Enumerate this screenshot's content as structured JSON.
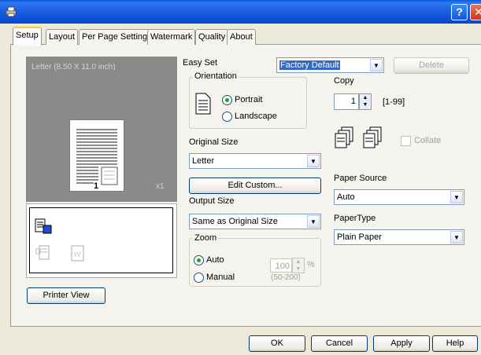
{
  "window": {
    "help_button": "?",
    "close_button": "✕"
  },
  "tabs": [
    "Setup",
    "Layout",
    "Per Page Setting",
    "Watermark",
    "Quality",
    "About"
  ],
  "preview": {
    "paper_label": "Letter  (8.50 X 11.0 inch)",
    "page_number": "1",
    "copies_marker": "x1",
    "printer_view_button": "Printer View"
  },
  "easy_set": {
    "label": "Easy Set",
    "value": "Factory Default",
    "delete_button": "Delete"
  },
  "orientation": {
    "legend": "Orientation",
    "portrait": "Portrait",
    "landscape": "Landscape",
    "selected": "Portrait"
  },
  "original_size": {
    "label": "Original Size",
    "value": "Letter",
    "edit_custom_button": "Edit Custom..."
  },
  "output_size": {
    "label": "Output Size",
    "value": "Same as Original Size"
  },
  "zoom": {
    "legend": "Zoom",
    "auto": "Auto",
    "manual": "Manual",
    "selected": "Auto",
    "value": "100",
    "unit": "%",
    "range": "(50-200)"
  },
  "copy": {
    "label": "Copy",
    "value": "1",
    "range": "[1-99]",
    "collate_label": "Collate"
  },
  "paper_source": {
    "label": "Paper Source",
    "value": "Auto"
  },
  "paper_type": {
    "label": "PaperType",
    "value": "Plain Paper"
  },
  "footer": {
    "ok": "OK",
    "cancel": "Cancel",
    "apply": "Apply",
    "help": "Help"
  },
  "colors": {
    "titlebar": "#0b4fd6",
    "accent_tab": "#ffc83c",
    "dialog_bg": "#ece9d8"
  }
}
